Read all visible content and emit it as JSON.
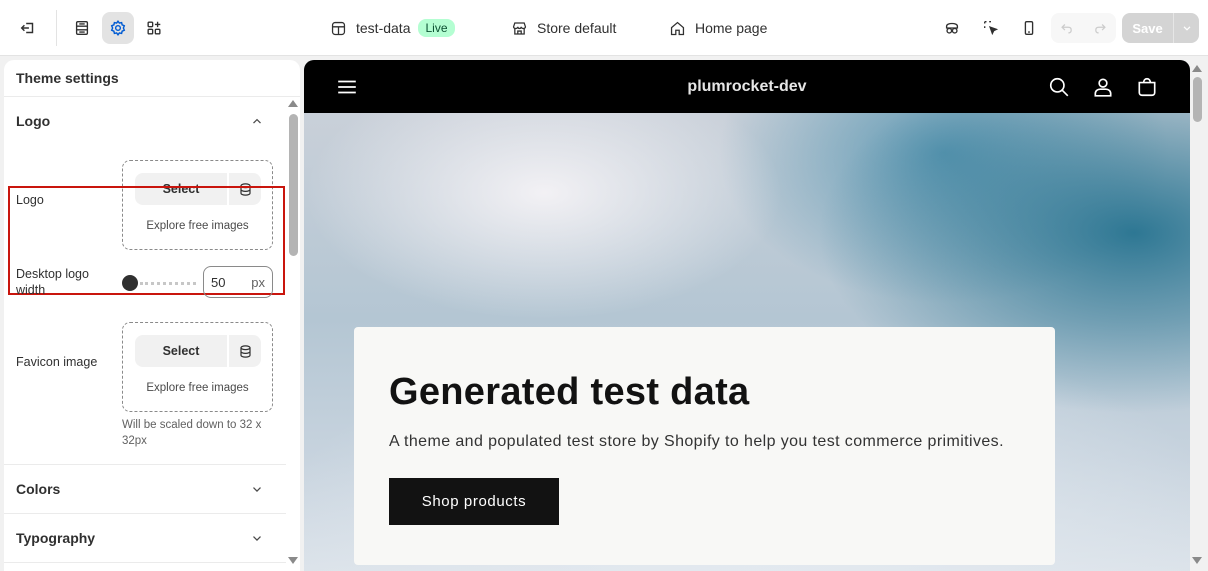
{
  "topbar": {
    "exit_icon": "exit-icon",
    "sections_icon": "sections-icon",
    "settings_icon": "gear-icon",
    "apps_icon": "apps-icon",
    "theme_name": "test-data",
    "live_badge": "Live",
    "store_label": "Store default",
    "page_label": "Home page",
    "save_label": "Save"
  },
  "sidebar": {
    "title": "Theme settings",
    "logo_section": {
      "heading": "Logo",
      "logo_field": {
        "label": "Logo",
        "select_label": "Select",
        "explore_label": "Explore free images"
      },
      "desktop_logo_width": {
        "label": "Desktop logo width",
        "value": "50",
        "unit": "px",
        "slider_fraction": 0
      },
      "favicon_field": {
        "label": "Favicon image",
        "select_label": "Select",
        "explore_label": "Explore free images",
        "help": "Will be scaled down to 32 x 32px"
      }
    },
    "colors_heading": "Colors",
    "typography_heading": "Typography"
  },
  "preview": {
    "store_name": "plumrocket-dev",
    "hero_title": "Generated test data",
    "hero_text": "A theme and populated test store by Shopify to help you test commerce primitives.",
    "hero_button": "Shop products"
  },
  "colors": {
    "highlight": "#c9150d",
    "live_badge_bg": "#b4fed2",
    "active_tool_bg": "#e3e3e3",
    "store_header_bg": "#000000"
  }
}
